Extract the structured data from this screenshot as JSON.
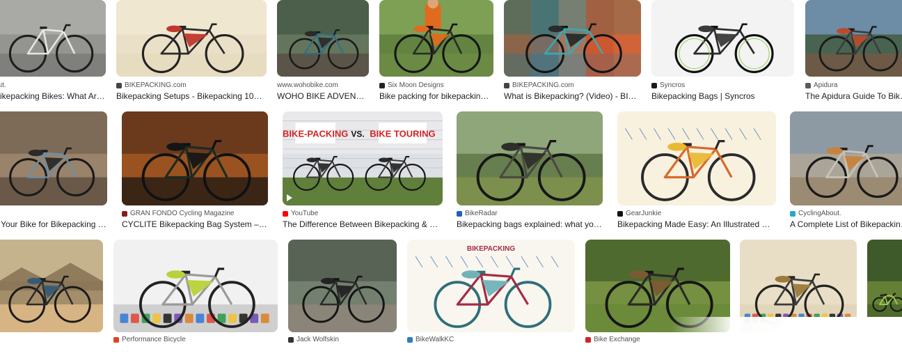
{
  "colors": {
    "text": "#1f1f1f",
    "source": "#4d5156",
    "background": "#ffffff"
  },
  "results": [
    {
      "id": "r1c1",
      "source": "out.",
      "title": "Bikepacking Bikes: What Are ...",
      "favicon": "none",
      "image": "gravel bike with frame bags against grey wall"
    },
    {
      "id": "r1c2",
      "source": "BIKEPACKING.com",
      "title": "Bikepacking Setups - Bikepacking 101 - B...",
      "favicon": "bikepacking",
      "image": "touring bike with panniers on cream background"
    },
    {
      "id": "r1c3",
      "source": "www.wohobike.com",
      "title": "WOHO BIKE ADVENTURE...",
      "favicon": "none",
      "image": "blue bike with bags on forest trail"
    },
    {
      "id": "r1c4",
      "source": "Six Moon Designs",
      "title": "Bike packing for bikepacking b...",
      "favicon": "sixmoon",
      "image": "rider in orange jacket with bike"
    },
    {
      "id": "r1c5",
      "source": "BIKEPACKING.com",
      "title": "What is Bikepacking? (Video) - BIKEP...",
      "favicon": "bikepacking",
      "image": "collage of bikes with bags"
    },
    {
      "id": "r1c6",
      "source": "Syncros",
      "title": "Bikepacking Bags | Syncros",
      "favicon": "syncros",
      "image": "black gravel bike with green accents on white"
    },
    {
      "id": "r1c7",
      "source": "Apidura",
      "title": "The Apidura Guide To Bikepa...",
      "favicon": "apidura",
      "image": "loaded bike by lake and mountains"
    },
    {
      "id": "r2c1",
      "source": "",
      "title": "k Your Bike for Bikepacking | L...",
      "favicon": "none",
      "image": "bike with bags on wooden bench"
    },
    {
      "id": "r2c2",
      "source": "GRAN FONDO Cycling Magazine",
      "title": "CYCLITE Bikepacking Bag System – Light...",
      "favicon": "granfondo",
      "image": "dark bike with bags in autumn forest"
    },
    {
      "id": "r2c3",
      "source": "YouTube",
      "title": "The Difference Between Bikepacking & Bike T...",
      "favicon": "youtube",
      "image": "bikepacking vs bike touring thumbnail",
      "overlay_left": "BIKE-PACKING",
      "overlay_vs": "VS.",
      "overlay_right": "BIKE TOURING"
    },
    {
      "id": "r2c4",
      "source": "BikeRadar",
      "title": "Bikepacking bags explained: what you ne...",
      "favicon": "bikeradar",
      "image": "bike in green valley landscape"
    },
    {
      "id": "r2c5",
      "source": "GearJunkie",
      "title": "Bikepacking Made Easy: An Illustrated How-T...",
      "favicon": "gearjunkie",
      "image": "illustrated bikepacking diagram"
    },
    {
      "id": "r2c6",
      "source": "CyclingAbout.",
      "title": "A Complete List of Bikepacking B...",
      "favicon": "cyclingabout",
      "image": "bike with bags by river"
    },
    {
      "id": "r3c1",
      "source": "",
      "title": "",
      "favicon": "none",
      "image": "rider on desert road with mountains"
    },
    {
      "id": "r3c2",
      "source": "Performance Bicycle",
      "title": "",
      "favicon": "performance",
      "image": "bike with gear flat lay"
    },
    {
      "id": "r3c3",
      "source": "Jack Wolfskin",
      "title": "",
      "favicon": "jackwolfskin",
      "image": "bike with bags on riverbank"
    },
    {
      "id": "r3c4",
      "source": "BikeWalkKC",
      "title": "",
      "favicon": "bikewalkkc",
      "image": "illustrated bikepacking poster",
      "overlay_title": "BIKEPACKING"
    },
    {
      "id": "r3c5",
      "source": "Bike Exchange",
      "title": "",
      "favicon": "bikeexchange",
      "image": "bike with bags on grass"
    },
    {
      "id": "r3c6",
      "source": "",
      "title": "",
      "favicon": "none",
      "image": "bike and gear flat lay on beige"
    },
    {
      "id": "r3c7",
      "source": "",
      "title": "",
      "favicon": "none",
      "image": "green bike in forest"
    }
  ]
}
